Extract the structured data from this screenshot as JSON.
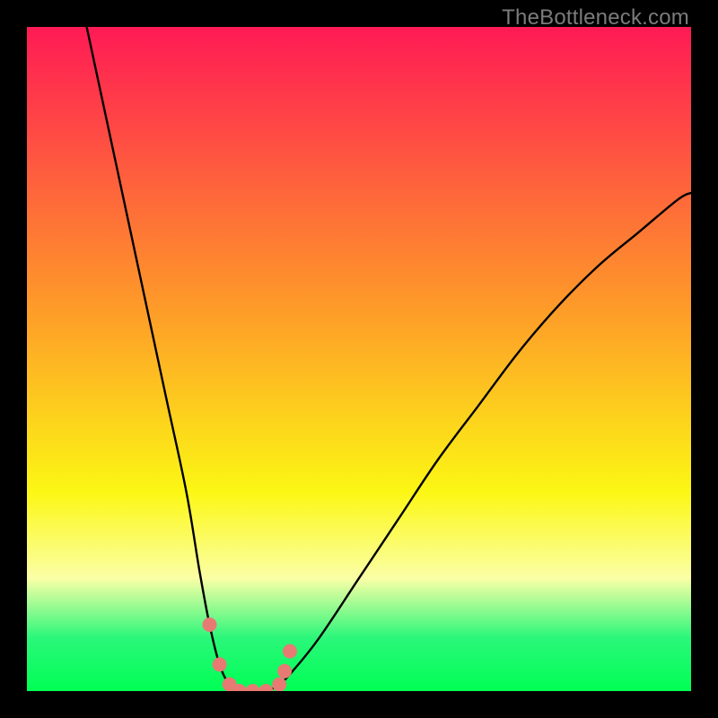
{
  "watermark": "TheBottleneck.com",
  "colors": {
    "black": "#000000",
    "top_red": "#ff1a55",
    "orange": "#fe9a29",
    "yellow": "#fcf714",
    "pale_yellow": "#fbffa6",
    "green_band": "#2af77a",
    "bright_green": "#00ff54",
    "curve": "#000000",
    "dot": "#e77a73",
    "watermark_text": "#7b7b7b"
  },
  "chart_data": {
    "type": "line",
    "title": "",
    "xlabel": "",
    "ylabel": "",
    "xlim": [
      0,
      100
    ],
    "ylim": [
      0,
      100
    ],
    "series": [
      {
        "name": "curve",
        "x": [
          9,
          12,
          15,
          18,
          21,
          24,
          26,
          27.5,
          29,
          30.5,
          32,
          34,
          36,
          38,
          40,
          44,
          50,
          56,
          62,
          68,
          74,
          80,
          86,
          92,
          98,
          100
        ],
        "y": [
          100,
          86,
          72,
          58,
          44,
          30,
          18,
          10,
          4,
          1,
          0,
          0,
          0,
          1,
          3,
          8,
          17,
          26,
          35,
          43,
          51,
          58,
          64,
          69,
          74,
          75
        ]
      }
    ],
    "markers": {
      "name": "dots",
      "x": [
        27.5,
        29,
        30.5,
        32,
        34,
        36,
        38,
        38.8,
        39.6
      ],
      "y": [
        10,
        4,
        1,
        0,
        0,
        0,
        1,
        3,
        6
      ]
    },
    "gradient_stops_pct_from_top": {
      "0": "#ff1a55",
      "42": "#fe9a29",
      "70": "#fcf714",
      "83": "#fbffa6",
      "92": "#2af77a",
      "100": "#00ff54"
    }
  }
}
